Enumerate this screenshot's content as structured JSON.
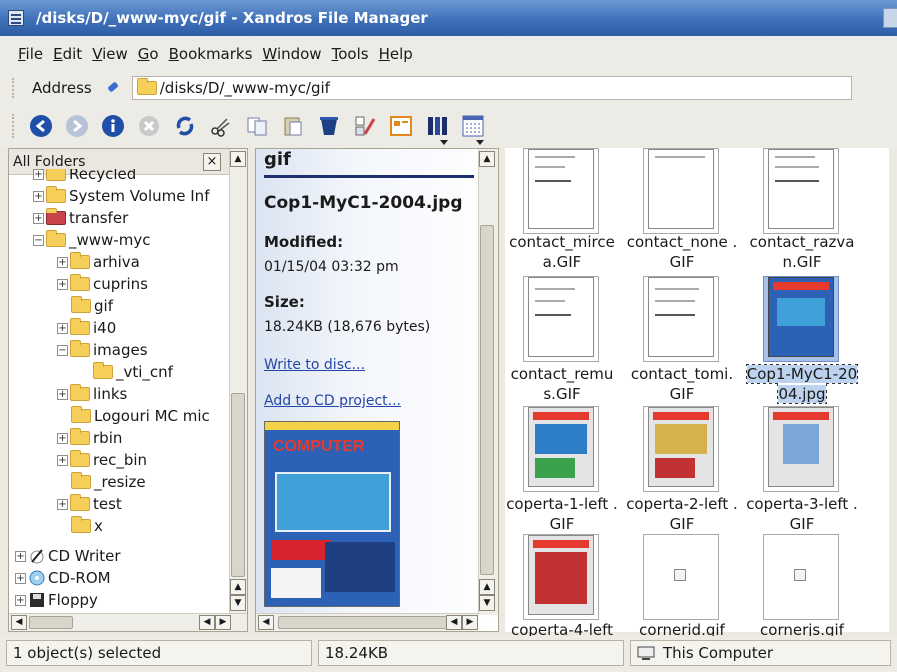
{
  "window": {
    "title": "/disks/D/_www-myc/gif - Xandros File Manager"
  },
  "menu": [
    "File",
    "Edit",
    "View",
    "Go",
    "Bookmarks",
    "Window",
    "Tools",
    "Help"
  ],
  "address": {
    "label": "Address",
    "value": "/disks/D/_www-myc/gif"
  },
  "toolbar": {
    "icons": [
      "back-icon",
      "forward-icon",
      "info-icon",
      "stop-icon",
      "refresh-icon",
      "cut-icon",
      "copy-icon",
      "paste-icon",
      "delete-icon",
      "properties-icon",
      "tile-view-icon",
      "column-view-icon",
      "detail-view-icon"
    ]
  },
  "tree": {
    "header": "All Folders",
    "close_label": "×",
    "items": [
      {
        "label": "Recycled",
        "expander": "+"
      },
      {
        "label": "System Volume Inf",
        "expander": "+"
      },
      {
        "label": "transfer",
        "expander": "+"
      },
      {
        "label": "_www-myc",
        "expander": "−"
      },
      {
        "label": "arhiva",
        "expander": "+"
      },
      {
        "label": "cuprins",
        "expander": "+"
      },
      {
        "label": "gif",
        "expander": ""
      },
      {
        "label": "i40",
        "expander": "+"
      },
      {
        "label": "images",
        "expander": "−"
      },
      {
        "label": "_vti_cnf",
        "expander": ""
      },
      {
        "label": "links",
        "expander": "+"
      },
      {
        "label": "Logouri MC mic",
        "expander": ""
      },
      {
        "label": "rbin",
        "expander": "+"
      },
      {
        "label": "rec_bin",
        "expander": "+"
      },
      {
        "label": "_resize",
        "expander": ""
      },
      {
        "label": "test",
        "expander": "+"
      },
      {
        "label": "x",
        "expander": ""
      },
      {
        "label": "CD Writer",
        "expander": "+"
      },
      {
        "label": "CD-ROM",
        "expander": "+"
      },
      {
        "label": "Floppy",
        "expander": "+"
      }
    ]
  },
  "info": {
    "folder": "gif",
    "filename": "Cop1-MyC1-2004.jpg",
    "modified_label": "Modified:",
    "modified_value": "01/15/04 03:32 pm",
    "size_label": "Size:",
    "size_value": "18.24KB (18,676 bytes)",
    "write_link": "Write to disc...",
    "cd_link": "Add to CD project...",
    "cover_brand": "COMPUTER"
  },
  "icons": [
    {
      "label": "contact_mirce a.GIF",
      "selected": false
    },
    {
      "label": "contact_none .GIF",
      "selected": false
    },
    {
      "label": "contact_razva n.GIF",
      "selected": false
    },
    {
      "label": "contact_remu s.GIF",
      "selected": false
    },
    {
      "label": "contact_tomi. GIF",
      "selected": false
    },
    {
      "label": "Cop1-MyC1-20 04.jpg",
      "selected": true
    },
    {
      "label": "coperta-1-left .GIF",
      "selected": false
    },
    {
      "label": "coperta-2-left .GIF",
      "selected": false
    },
    {
      "label": "coperta-3-left .GIF",
      "selected": false
    },
    {
      "label": "coperta-4-left",
      "selected": false
    },
    {
      "label": "cornerid.gif",
      "selected": false
    },
    {
      "label": "cornerjs.gif",
      "selected": false
    }
  ],
  "status": {
    "selected": "1 object(s) selected",
    "size": "18.24KB",
    "location": "This Computer"
  }
}
